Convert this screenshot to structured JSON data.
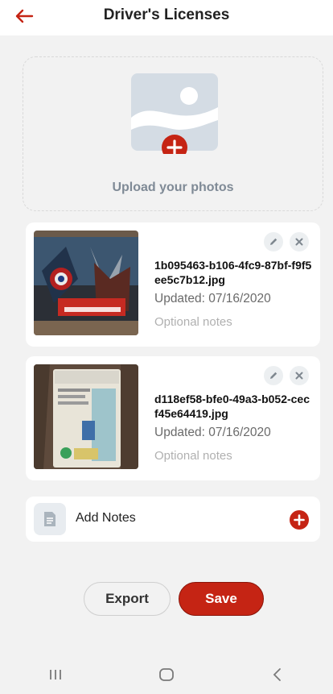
{
  "header": {
    "title": "Driver's Licenses",
    "back_icon": "arrow-left-icon"
  },
  "upload": {
    "label": "Upload your photos",
    "icon": "image-add-icon"
  },
  "photos": [
    {
      "filename": "1b095463-b106-4fc9-87bf-f9f5ee5c7b12.jpg",
      "updated": "Updated: 07/16/2020",
      "notes_placeholder": "Optional notes"
    },
    {
      "filename": "d118ef58-bfe0-49a3-b052-cecf45e64419.jpg",
      "updated": "Updated: 07/16/2020",
      "notes_placeholder": "Optional notes"
    }
  ],
  "add_notes": {
    "label": "Add Notes"
  },
  "actions": {
    "export_label": "Export",
    "save_label": "Save"
  },
  "colors": {
    "accent": "#c52414",
    "background": "#f2f2f2"
  }
}
